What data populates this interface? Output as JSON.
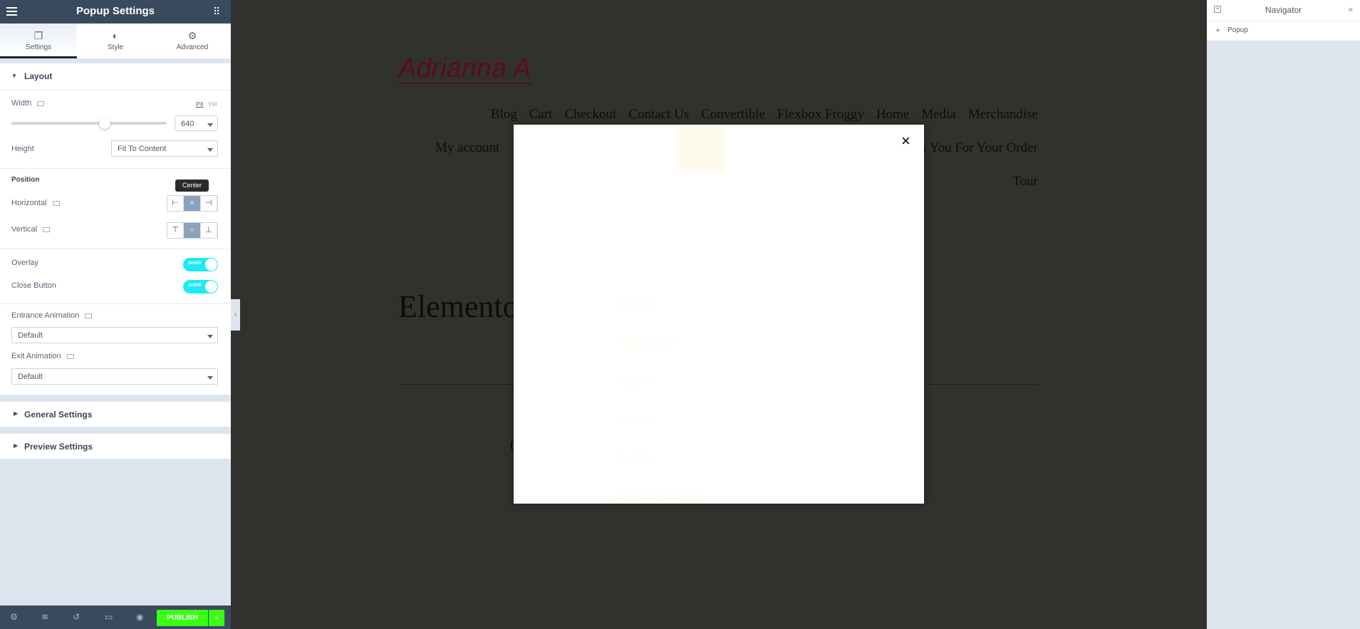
{
  "panel": {
    "title": "Popup Settings",
    "tabs": [
      {
        "label": "Settings",
        "icon": "window-restore-icon"
      },
      {
        "label": "Style",
        "icon": "half-circle-icon"
      },
      {
        "label": "Advanced",
        "icon": "gear-icon"
      }
    ],
    "layout": {
      "title": "Layout",
      "width_label": "Width",
      "unit_px": "PX",
      "unit_vw": "VW",
      "width_value": "640",
      "width_slider_fraction": 0.6,
      "height_label": "Height",
      "height_value": "Fit To Content",
      "position_label": "Position",
      "horizontal_label": "Horizontal",
      "vertical_label": "Vertical",
      "tooltip": "Center",
      "overlay_label": "Overlay",
      "overlay_toggle": "SHOW",
      "close_label": "Close Button",
      "close_toggle": "SHOW",
      "entrance_label": "Entrance Animation",
      "entrance_value": "Default",
      "exit_label": "Exit Animation",
      "exit_value": "Default"
    },
    "general_settings": "General Settings",
    "preview_settings": "Preview Settings",
    "publish": "PUBLISH",
    "colors": {
      "publish": "#39ff14",
      "toggle": "#1de9f6",
      "header": "#3a4a5e"
    }
  },
  "site": {
    "logo": "Adrianna A",
    "nav_row1": [
      "Blog",
      "Cart",
      "Checkout",
      "Contact Us",
      "Convertible",
      "Flexbox Froggy",
      "Home",
      "Media",
      "Merchandise"
    ],
    "nav_row2_left": "My account",
    "nav_row2_right": "k You For Your Order",
    "nav_row3": "Tour",
    "heading": "Elemento",
    "partial": "("
  },
  "popup": {
    "close": "×",
    "menu": [
      "HOME",
      "PRESS KIT",
      "MEDIA",
      "TOUR",
      "BLOG",
      "MERCHANDISE"
    ]
  },
  "navigator": {
    "title": "Navigator",
    "item": "Popup"
  }
}
